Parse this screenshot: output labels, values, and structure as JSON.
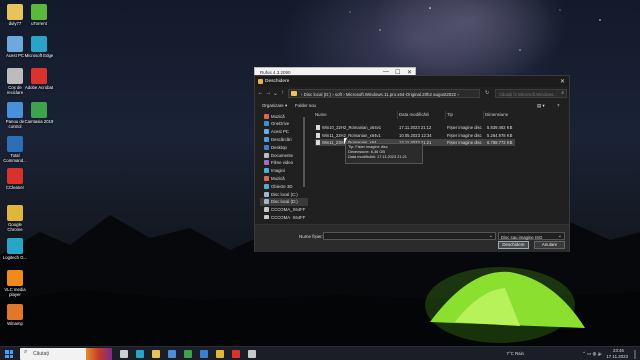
{
  "desktop": {
    "icons": [
      {
        "label": "duly77",
        "icon": "user-folder-icon",
        "color": "#e8c25a"
      },
      {
        "label": "uTorrent",
        "icon": "utorrent-icon",
        "color": "#5bb83a"
      },
      {
        "label": "Acest PC",
        "icon": "computer-icon",
        "color": "#6fa8dc"
      },
      {
        "label": "Microsoft Edge",
        "icon": "edge-icon",
        "color": "#2aa3c8"
      },
      {
        "label": "Coș de reciclare",
        "icon": "recycle-bin-icon",
        "color": "#bcbcbc"
      },
      {
        "label": "Adobe Acrobat",
        "icon": "acrobat-icon",
        "color": "#d9342b"
      },
      {
        "label": "Panou de control",
        "icon": "control-panel-icon",
        "color": "#4a90d9"
      },
      {
        "label": "Camtasia 2019",
        "icon": "camtasia-icon",
        "color": "#3fa34d"
      },
      {
        "label": "Total Command...",
        "icon": "total-commander-icon",
        "color": "#2d6fb5"
      },
      {
        "label": "CCleaner",
        "icon": "ccleaner-icon",
        "color": "#d8332b"
      },
      {
        "label": "Google Chrome",
        "icon": "chrome-icon",
        "color": "#e2b53b"
      },
      {
        "label": "Logitech G...",
        "icon": "logitech-icon",
        "color": "#27a6c9"
      },
      {
        "label": "VLC media player",
        "icon": "vlc-icon",
        "color": "#f08a1c"
      },
      {
        "label": "Winamp",
        "icon": "winamp-icon",
        "color": "#e0772a"
      }
    ]
  },
  "bg_window": {
    "title": "Rufus 4.3.2090",
    "min": "—",
    "max": "☐",
    "close": "✕"
  },
  "dialog": {
    "title": "Deschidere",
    "close": "✕",
    "nav": {
      "back": "←",
      "forward": "→",
      "up_history": "⌄",
      "up": "↑"
    },
    "breadcrumb": "› Disc local (D:)  ›  soft  ›  Microsoft.Windows.11.pro.x64-Original.20h2 august2022  ›",
    "refresh": "↻",
    "search_placeholder": "Căutați în Microsoft.Windows...",
    "toolbar": {
      "organize": "Organizare ▾",
      "new_folder": "Folder nou",
      "view": "▤ ▾",
      "help": "?"
    },
    "nav_items": [
      {
        "label": "Muzică",
        "icon": "music-icon",
        "color": "#e1645b"
      },
      {
        "label": "OneDrive",
        "icon": "onedrive-icon",
        "color": "#3b8fd8"
      },
      {
        "label": "Acest PC",
        "icon": "computer-icon",
        "color": "#6fa8dc"
      },
      {
        "label": "Descărcări",
        "icon": "download-icon",
        "color": "#4aa0e0"
      },
      {
        "label": "Desktop",
        "icon": "desktop-icon",
        "color": "#3a7fd0"
      },
      {
        "label": "Documente",
        "icon": "documents-icon",
        "color": "#bdbdbd"
      },
      {
        "label": "Filme video",
        "icon": "video-icon",
        "color": "#9a6fd0"
      },
      {
        "label": "Imagini",
        "icon": "pictures-icon",
        "color": "#4ab0d8"
      },
      {
        "label": "Muzică",
        "icon": "music-icon",
        "color": "#e1645b"
      },
      {
        "label": "Obiecte 3D",
        "icon": "3d-objects-icon",
        "color": "#4ab0d8"
      },
      {
        "label": "Disc local (C:)",
        "icon": "drive-icon",
        "color": "#9fb8d0"
      },
      {
        "label": "Disc local (D:)",
        "icon": "drive-icon",
        "color": "#9fb8d0"
      },
      {
        "label": "CCCOMA_X64FF",
        "icon": "dvd-drive-icon",
        "color": "#c8c8c8"
      },
      {
        "label": "CCCOMA_X64FF",
        "icon": "dvd-drive-icon",
        "color": "#c8c8c8"
      }
    ],
    "columns": {
      "name": "Nume",
      "date": "Data modificării",
      "type": "Tip",
      "size": "Dimensiune"
    },
    "files": [
      {
        "name": "Win10_22H2_Romanian_x64v1",
        "date": "17.11.2023 21:12",
        "type": "Fișier imagine disc",
        "size": "5.839.462 KB"
      },
      {
        "name": "Win11_22H2_Romanian_x64v1",
        "date": "10.05.2023 12:34",
        "type": "Fișier imagine disc",
        "size": "5.264.978 KB"
      },
      {
        "name": "Win11_23H2_Romanian_x64",
        "date": "17.11.2023 21:21",
        "type": "Fișier imagine disc",
        "size": "6.758.772 KB"
      }
    ],
    "tooltip": {
      "line1": "Tip: Fișier imagine disc",
      "line2": "Dimensiune: 6,36 GB",
      "line3": "Data modificării: 17.11.2023 21:21"
    },
    "footer": {
      "filename_label": "Nume fișier:",
      "filename_value": "",
      "filetype": "Disc sau imagine ISO",
      "open": "Deschidere",
      "cancel": "Anulare",
      "dropdown": "⌄"
    }
  },
  "taskbar": {
    "search_placeholder": "Căutați",
    "apps": [
      {
        "icon": "task-view-icon",
        "color": "#cfcfcf"
      },
      {
        "icon": "edge-icon",
        "color": "#2aa3c8"
      },
      {
        "icon": "file-explorer-icon",
        "color": "#e8c25a"
      },
      {
        "icon": "store-icon",
        "color": "#4a90d9"
      },
      {
        "icon": "camtasia-icon",
        "color": "#3fa34d"
      },
      {
        "icon": "mail-icon",
        "color": "#3a7fd0"
      },
      {
        "icon": "chrome-icon",
        "color": "#e2b53b"
      },
      {
        "icon": "acrobat-icon",
        "color": "#d9342b"
      },
      {
        "icon": "rufus-icon",
        "color": "#c9c9c9"
      }
    ],
    "weather": "7°C  Rain",
    "tray_icons": "⌃  ▭  ◍  🔈",
    "time": "23:46",
    "date": "17.11.2023"
  }
}
